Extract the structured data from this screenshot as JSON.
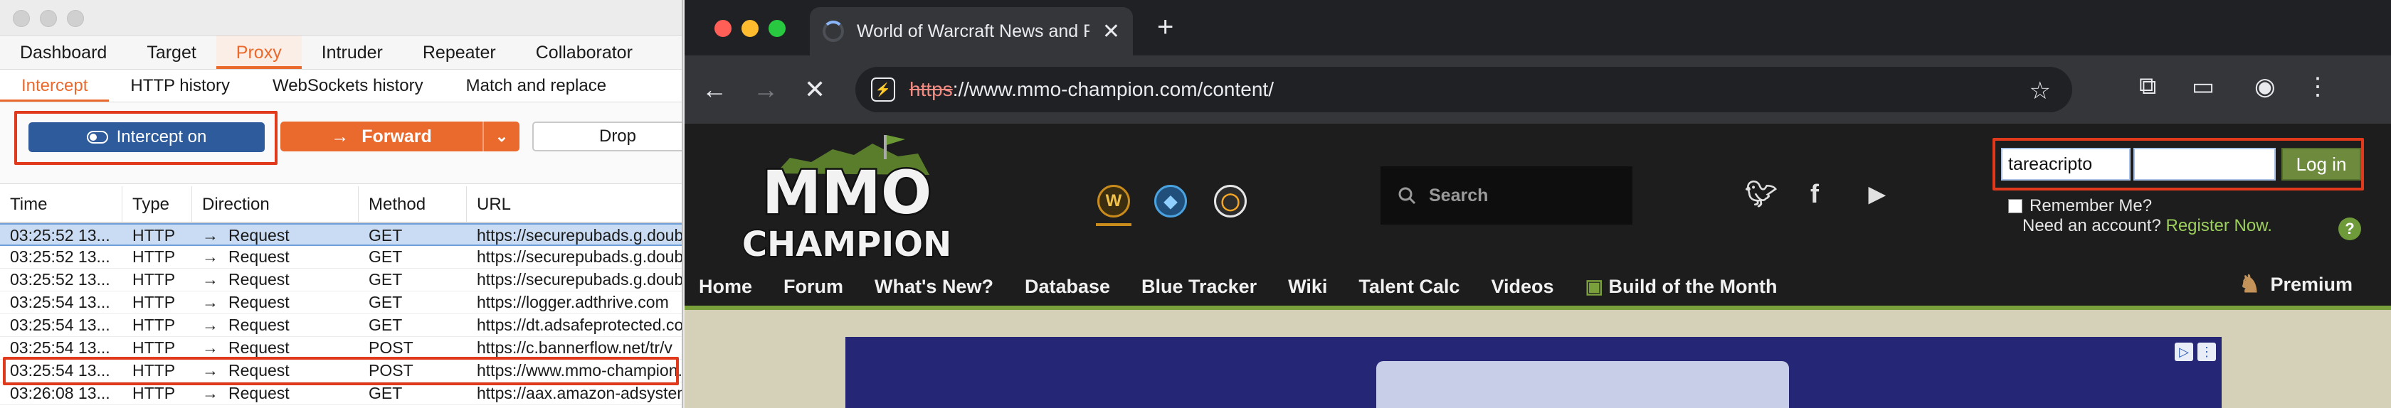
{
  "burp": {
    "main_tabs": [
      "Dashboard",
      "Target",
      "Proxy",
      "Intruder",
      "Repeater",
      "Collaborator"
    ],
    "active_main_tab": "Proxy",
    "sub_tabs": [
      "Intercept",
      "HTTP history",
      "WebSockets history",
      "Match and replace"
    ],
    "active_sub_tab": "Intercept",
    "toolbar": {
      "intercept_label": "Intercept on",
      "forward_label": "Forward",
      "drop_label": "Drop"
    },
    "table": {
      "headers": [
        "Time",
        "Type",
        "Direction",
        "Method",
        "URL"
      ],
      "rows": [
        {
          "time": "03:25:52 13...",
          "type": "HTTP",
          "direction": "Request",
          "method": "GET",
          "url": "https://securepubads.g.doubleclick.net"
        },
        {
          "time": "03:25:52 13...",
          "type": "HTTP",
          "direction": "Request",
          "method": "GET",
          "url": "https://securepubads.g.doubleclick.net"
        },
        {
          "time": "03:25:52 13...",
          "type": "HTTP",
          "direction": "Request",
          "method": "GET",
          "url": "https://securepubads.g.doubleclick.net"
        },
        {
          "time": "03:25:54 13...",
          "type": "HTTP",
          "direction": "Request",
          "method": "GET",
          "url": "https://logger.adthrive.com"
        },
        {
          "time": "03:25:54 13...",
          "type": "HTTP",
          "direction": "Request",
          "method": "GET",
          "url": "https://dt.adsafeprotected.com"
        },
        {
          "time": "03:25:54 13...",
          "type": "HTTP",
          "direction": "Request",
          "method": "POST",
          "url": "https://c.bannerflow.net/tr/v"
        },
        {
          "time": "03:25:54 13...",
          "type": "HTTP",
          "direction": "Request",
          "method": "POST",
          "url": "https://www.mmo-champion.com"
        },
        {
          "time": "03:26:08 13...",
          "type": "HTTP",
          "direction": "Request",
          "method": "GET",
          "url": "https://aax.amazon-adsystem.com"
        }
      ]
    }
  },
  "chrome": {
    "tab_title": "World of Warcraft News and Raiding Strategies",
    "url_scheme": "https",
    "url_rest": "://www.mmo-champion.com/content/"
  },
  "site": {
    "logo_top": "MMO",
    "logo_bottom": "CHAMPION",
    "search_placeholder": "Search",
    "login": {
      "username_value": "tareacripto",
      "password_value": "",
      "login_label": "Log in",
      "remember_label": "Remember Me?",
      "need_account": "Need an account?",
      "register_label": "Register Now.",
      "help_label": "?"
    },
    "nav_items": [
      "Home",
      "Forum",
      "What's New?",
      "Database",
      "Blue Tracker",
      "Wiki",
      "Talent Calc",
      "Videos"
    ],
    "build_label": "Build of the Month",
    "premium_label": "Premium"
  },
  "colors": {
    "burp_accent": "#ea6a2e",
    "intercept_button": "#2e5b9c",
    "highlight_red": "#e0391c",
    "site_green": "#7aa03c"
  }
}
